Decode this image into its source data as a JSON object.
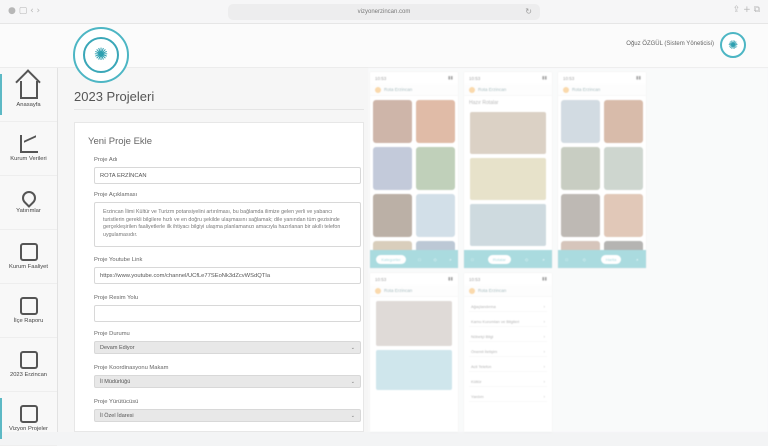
{
  "browser": {
    "url": "vizyonerzincan.com",
    "traffic": "● ▢ ‹ ›",
    "right_icons": "⇪  +  ⧉"
  },
  "header": {
    "logo_symbol": "✺",
    "user": "Oğuz ÖZGÜL (Sistem Yöneticisi)",
    "user_logo_symbol": "✺"
  },
  "sidebar": {
    "items": [
      {
        "label": "Anasayfa",
        "icon": "home-icon"
      },
      {
        "label": "Kurum Verileri",
        "icon": "chart-line-icon"
      },
      {
        "label": "Yatırımlar",
        "icon": "map-pin-icon"
      },
      {
        "label": "Kurum Faaliyet",
        "icon": "folder-icon"
      },
      {
        "label": "İlçe Raporu",
        "icon": "folder-open-icon"
      },
      {
        "label": "2023 Erzincan",
        "icon": "monitor-icon"
      },
      {
        "label": "Vizyon Projeler",
        "icon": "image-icon"
      }
    ]
  },
  "main": {
    "page_title": "2023 Projeleri",
    "form_title": "Yeni Proje Ekle",
    "fields": {
      "project_name_label": "Proje Adı",
      "project_name_value": "ROTA ERZİNCAN",
      "description_label": "Proje Açıklaması",
      "description_value": "Erzincan İlimi Kültür ve Turizm potansiyelini artırılması, bu bağlamda ilimize gelen yerli ve yabancı turistlerin gerekli bilgilere hızlı ve en doğru şekilde ulaşmasını sağlamak; dile yanından tüm gezisinde gerçekleşirilen faaliyetlerle ilk ihtiyacı bilgiyi ulaşma planlamanızı amacıyla hazırlanan bir akıllı telefon uygulamasıdır.",
      "youtube_label": "Proje Youtube Link",
      "youtube_value": "https://www.youtube.com/channel/UCfLe77SEoNk3dZcvWSdQTIa",
      "image_path_label": "Proje Resim Yolu",
      "image_path_value": "",
      "status_label": "Proje Durumu",
      "status_value": "Devam Ediyor",
      "coordinator_label": "Proje Koordinasyonu Makam",
      "coordinator_value": "İl Müdürlüğü",
      "manager_label": "Proje Yürütücüsü",
      "manager_value": "İl Özel İdaresi"
    }
  },
  "phones": {
    "time": "10:53",
    "app_name": "Rota Erzincan",
    "ready_routes": "Hazır Rotalar",
    "tab_categories": "Kategoriler",
    "tab_routes": "Rotalar",
    "tab_map": "Harita",
    "tab_list": "Menü",
    "menu_items": [
      "Ağaçlandırma",
      "Kamu Kurumları ve Bilgileri",
      "Nöbetçi Bilgi",
      "Önemli İletişim",
      "Acil Telefon",
      "Kültür",
      "Yardım"
    ]
  },
  "colors": {
    "accent": "#4db6c4",
    "tabbar": "#35a9b3"
  }
}
